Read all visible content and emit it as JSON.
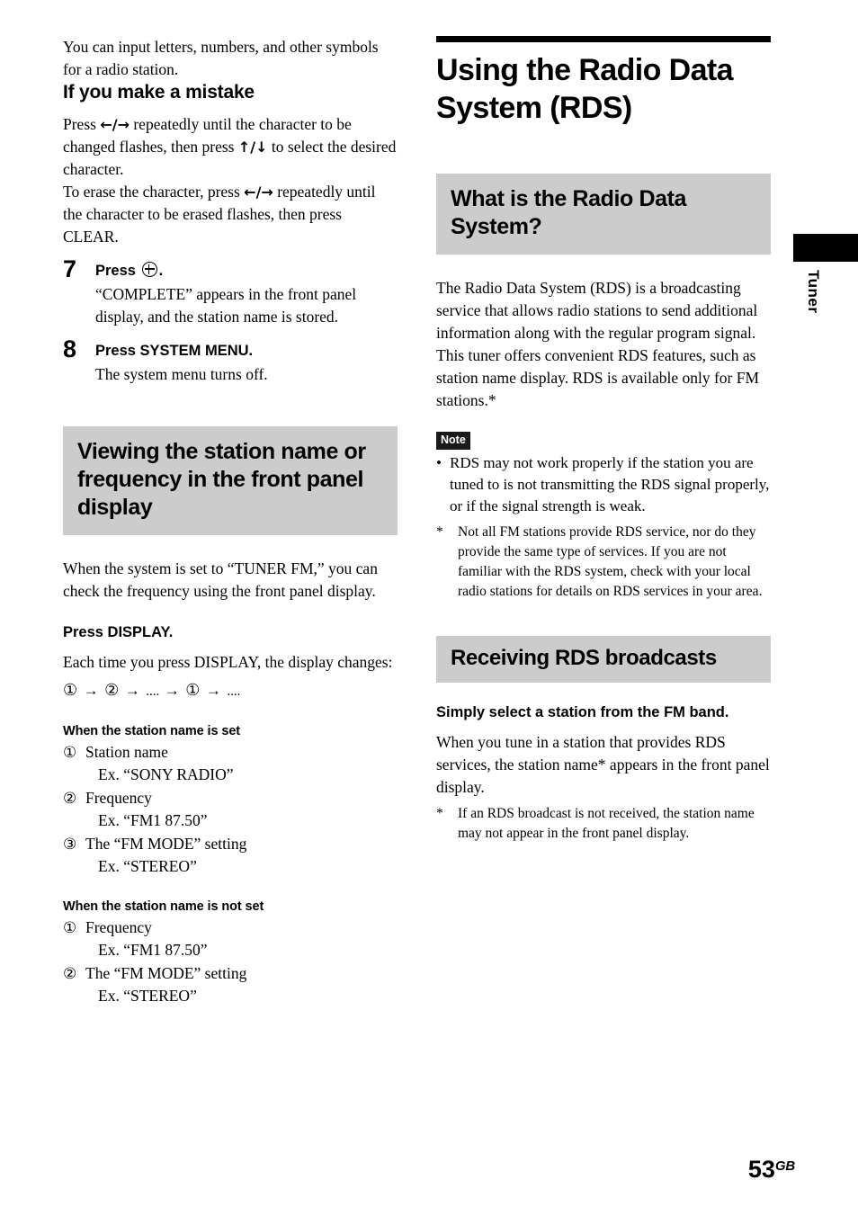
{
  "page": {
    "number": "53",
    "region_code": "GB",
    "edge_tab_label": "Tuner"
  },
  "left_column": {
    "intro": "You can input letters, numbers, and other symbols for a radio station.",
    "mistake_heading": "If you make a mistake",
    "mistake_p1_a": "Press ",
    "mistake_p1_arrows1": "←/→",
    "mistake_p1_b": " repeatedly until the character to be changed flashes, then press ",
    "mistake_p1_arrows2": "↑/↓",
    "mistake_p1_c": " to select the desired character.",
    "mistake_p2_a": "To erase the character, press ",
    "mistake_p2_arrows": "←/→",
    "mistake_p2_b": " repeatedly until the character to be erased flashes, then press CLEAR.",
    "steps": [
      {
        "number": "7",
        "title_before": "Press",
        "title_icon": "enter-button-icon",
        "title_after": ".",
        "body": "“COMPLETE” appears in the front panel display, and the station name is stored."
      },
      {
        "number": "8",
        "title_before": "Press SYSTEM MENU.",
        "title_icon": "",
        "title_after": "",
        "body": "The system menu turns off."
      }
    ],
    "gray_heading": "Viewing the station name or frequency in the front panel display",
    "after_heading_text": "When the system is set to “TUNER FM,” you can check the frequency using the front panel display.",
    "press_display_heading": "Press DISPLAY.",
    "each_time_text": "Each time you press DISPLAY, the display changes:",
    "sequence": {
      "i1": "①",
      "a1": "→",
      "i2": "②",
      "a2": "→",
      "d1": "....",
      "a3": "→",
      "i3": "①",
      "a4": "→",
      "d2": "...."
    },
    "set_heading": "When the station name is set",
    "set_items": [
      {
        "mark": "①",
        "label": "Station name",
        "example": "Ex. “SONY RADIO”"
      },
      {
        "mark": "②",
        "label": "Frequency",
        "example": "Ex. “FM1 87.50”"
      },
      {
        "mark": "③",
        "label": "The “FM MODE” setting",
        "example": "Ex. “STEREO”"
      }
    ],
    "not_set_heading": "When the station name is not set",
    "not_set_items": [
      {
        "mark": "①",
        "label": "Frequency",
        "example": "Ex. “FM1 87.50”"
      },
      {
        "mark": "②",
        "label": "The “FM MODE” setting",
        "example": "Ex. “STEREO”"
      }
    ]
  },
  "right_column": {
    "chapter_title": "Using the Radio Data System (RDS)",
    "what_is_heading": "What is the Radio Data System?",
    "what_is_body": "The Radio Data System (RDS) is a broadcasting service that allows radio stations to send additional information along with the regular program signal. This tuner offers convenient RDS features, such as station name display. RDS is available only for FM stations.*",
    "note_badge": "Note",
    "note_bullet_mark": "•",
    "note_bullet_text": "RDS may not work properly if the station you are tuned to is not transmitting the RDS signal properly, or if the signal strength is weak.",
    "footnote_mark": "*",
    "footnote_text": "Not all FM stations provide RDS service, nor do they provide the same type of services. If you are not familiar with the RDS system, check with your local radio stations for details on RDS services in your area.",
    "receiving_heading": "Receiving RDS broadcasts",
    "simply_select_heading": "Simply select a station from the FM band.",
    "receiving_body": "When you tune in a station that provides RDS services, the station name* appears in the front panel display.",
    "receiving_footnote_mark": "*",
    "receiving_footnote_text": "If an RDS broadcast is not received, the station name may not appear in the front panel display."
  },
  "colors": {
    "heading_background": "#cccccc",
    "rule": "#000000",
    "note_badge_background": "#1a1a1a",
    "text": "#000000"
  }
}
